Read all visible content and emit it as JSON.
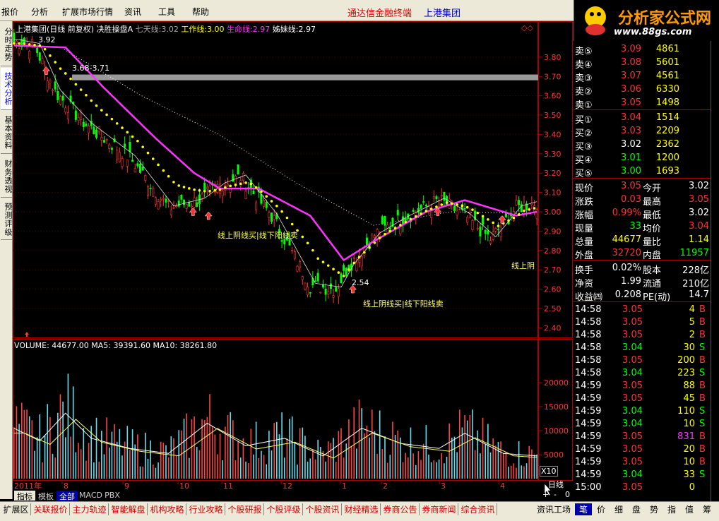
{
  "menu": {
    "items": [
      "报价",
      "分析",
      "扩展市场行情",
      "资讯",
      "工具",
      "帮助"
    ],
    "vendor": "通达信金融终端",
    "stock": "上港集团"
  },
  "logo": {
    "brand": "分析家公式网",
    "url": "www.88gs.com"
  },
  "vtabs": [
    "分时走势",
    "技术分析",
    "基本资料",
    "财务透视",
    "预测评级"
  ],
  "header": {
    "stock": "上港集团(日线 前复权)",
    "formula": "决胜操盘A",
    "ma7_label": "七天线:",
    "ma7_value": "3.02",
    "work_label": "工作线:",
    "work_value": "3.00",
    "life_label": "生命线:",
    "life_value": "2.97",
    "sister_label": "姊妹线:",
    "sister_value": "2.97",
    "diamond": "◇◇"
  },
  "price_axis": [
    "3.80",
    "3.70",
    "3.60",
    "3.50",
    "3.40",
    "3.30",
    "3.20",
    "3.10",
    "3.00",
    "2.90",
    "2.80",
    "2.70",
    "2.60",
    "2.50",
    "2.40"
  ],
  "annotations": {
    "high": "3.92",
    "band": "3.68-3.71",
    "low": "2.54",
    "signal1": "线上阴线买|线下阳线卖",
    "signal2": "线上阴线买|线下阳线卖",
    "signal3": "线上阴"
  },
  "volume": {
    "header": "VOLUME: 44677.00  MA5: 39391.60  MA10: 38261.80",
    "axis": [
      "20000",
      "15000",
      "10000",
      "5000"
    ],
    "unit": "X10"
  },
  "date_axis": {
    "year": "2011年",
    "months": [
      "8",
      "9",
      "10",
      "11",
      "12",
      "1",
      "2",
      "3",
      "4"
    ],
    "period": "日线"
  },
  "zoom": {
    "plus": "+",
    "minus": "-",
    "value": "0"
  },
  "chart_tabs": [
    "指标",
    "模板",
    "全部",
    "MACD",
    "PBX"
  ],
  "bottom_tabs": [
    "扩展区",
    "关联报价",
    "主力轨迹",
    "智能解盘",
    "机构攻略",
    "行业攻略",
    "个股研报",
    "个股评级",
    "个股资讯",
    "财经精选",
    "券商公告",
    "券商新闻",
    "综合资讯"
  ],
  "bottom_right_tab": "资讯工场",
  "right_tabs": [
    "笔",
    "价",
    "细",
    "盘",
    "势",
    "指",
    "值",
    "筹"
  ],
  "quote": {
    "asks": [
      {
        "label": "卖⑤",
        "price": "3.09",
        "vol": "4861"
      },
      {
        "label": "卖④",
        "price": "3.08",
        "vol": "5601"
      },
      {
        "label": "卖③",
        "price": "3.07",
        "vol": "4561"
      },
      {
        "label": "卖②",
        "price": "3.06",
        "vol": "6330"
      },
      {
        "label": "卖①",
        "price": "3.05",
        "vol": "1498"
      }
    ],
    "bids": [
      {
        "label": "买①",
        "price": "3.04",
        "vol": "1514"
      },
      {
        "label": "买②",
        "price": "3.03",
        "vol": "2209"
      },
      {
        "label": "买③",
        "price": "3.02",
        "vol": "2362"
      },
      {
        "label": "买④",
        "price": "3.01",
        "vol": "1200"
      },
      {
        "label": "买⑤",
        "price": "3.00",
        "vol": "1693"
      }
    ],
    "stats": [
      {
        "l1": "现价",
        "v1": "3.05",
        "c1": "#ff3333",
        "l2": "今开",
        "v2": "3.02",
        "c2": "#ffffff"
      },
      {
        "l1": "涨跌",
        "v1": "0.03",
        "c1": "#ff3333",
        "l2": "最高",
        "v2": "3.05",
        "c2": "#ff3333"
      },
      {
        "l1": "涨幅",
        "v1": "0.99%",
        "c1": "#ff3333",
        "l2": "最低",
        "v2": "3.02",
        "c2": "#ffffff"
      },
      {
        "l1": "现量",
        "v1": "33",
        "c1": "#00ff00",
        "l2": "均价",
        "v2": "3.04",
        "c2": "#ff3333"
      },
      {
        "l1": "总量",
        "v1": "44677",
        "c1": "#ffff00",
        "l2": "量比",
        "v2": "1.14",
        "c2": "#ffff00"
      },
      {
        "l1": "外盘",
        "v1": "32720",
        "c1": "#ff3333",
        "l2": "内盘",
        "v2": "11957",
        "c2": "#00ff00"
      }
    ],
    "fin": [
      {
        "l1": "换手",
        "v1": "0.02%",
        "l2": "股本",
        "v2": "228亿"
      },
      {
        "l1": "净资",
        "v1": "1.99",
        "l2": "流通",
        "v2": "210亿"
      },
      {
        "l1": "收益㈣",
        "v1": "0.208",
        "l2": "PE(动)",
        "v2": "14.7"
      }
    ]
  },
  "ticks": [
    {
      "t": "14:58",
      "p": "3.05",
      "v": "4",
      "s": "B"
    },
    {
      "t": "14:58",
      "p": "3.05",
      "v": "5",
      "s": "B"
    },
    {
      "t": "14:58",
      "p": "3.05",
      "v": "2",
      "s": "B"
    },
    {
      "t": "14:58",
      "p": "3.04",
      "v": "30",
      "s": "S"
    },
    {
      "t": "14:58",
      "p": "3.05",
      "v": "200",
      "s": "B"
    },
    {
      "t": "14:58",
      "p": "3.04",
      "v": "223",
      "s": "S"
    },
    {
      "t": "14:59",
      "p": "3.05",
      "v": "88",
      "s": "B"
    },
    {
      "t": "14:59",
      "p": "3.05",
      "v": "45",
      "s": "B"
    },
    {
      "t": "14:59",
      "p": "3.04",
      "v": "110",
      "s": "S"
    },
    {
      "t": "14:59",
      "p": "3.04",
      "v": "10",
      "s": "S"
    },
    {
      "t": "14:59",
      "p": "3.05",
      "v": "831",
      "s": "B"
    },
    {
      "t": "14:59",
      "p": "3.05",
      "v": "20",
      "s": "B"
    },
    {
      "t": "14:59",
      "p": "3.05",
      "v": "10",
      "s": "B"
    },
    {
      "t": "14:59",
      "p": "3.04",
      "v": "33",
      "s": "S"
    },
    {
      "t": "15:00",
      "p": "3.05",
      "v": "0",
      "s": ""
    }
  ],
  "chart_data": {
    "type": "candlestick",
    "price_range": [
      2.35,
      3.92
    ],
    "volume_range": [
      0,
      25000
    ],
    "close_keypoints": [
      [
        0,
        3.88
      ],
      [
        8,
        3.86
      ],
      [
        16,
        3.62
      ],
      [
        28,
        3.45
      ],
      [
        45,
        3.28
      ],
      [
        60,
        3.02
      ],
      [
        72,
        3.06
      ],
      [
        80,
        3.14
      ],
      [
        88,
        3.18
      ],
      [
        100,
        2.98
      ],
      [
        115,
        2.62
      ],
      [
        125,
        2.6
      ],
      [
        130,
        2.72
      ],
      [
        140,
        2.88
      ],
      [
        150,
        2.96
      ],
      [
        165,
        3.06
      ],
      [
        175,
        2.98
      ],
      [
        185,
        2.86
      ],
      [
        195,
        3.02
      ],
      [
        203,
        3.05
      ]
    ],
    "life_line_keypoints": [
      [
        0,
        3.86
      ],
      [
        20,
        3.85
      ],
      [
        35,
        3.64
      ],
      [
        55,
        3.38
      ],
      [
        70,
        3.2
      ],
      [
        80,
        3.12
      ],
      [
        95,
        3.12
      ],
      [
        115,
        2.98
      ],
      [
        128,
        2.75
      ],
      [
        140,
        2.85
      ],
      [
        160,
        3.0
      ],
      [
        175,
        3.06
      ],
      [
        195,
        2.98
      ],
      [
        203,
        3.0
      ]
    ],
    "ma_slow_keypoints": [
      [
        20,
        3.84
      ],
      [
        50,
        3.6
      ],
      [
        80,
        3.4
      ],
      [
        110,
        3.15
      ],
      [
        140,
        2.93
      ],
      [
        170,
        3.0
      ],
      [
        203,
        2.99
      ]
    ],
    "price_band": [
      3.68,
      3.71
    ],
    "arrows_up": [
      [
        13,
        3.75
      ],
      [
        70,
        3.02
      ],
      [
        76,
        3.0
      ],
      [
        132,
        2.62
      ],
      [
        165,
        3.02
      ],
      [
        190,
        2.98
      ]
    ],
    "volume_keypoints": [
      [
        0,
        10000
      ],
      [
        10,
        7500
      ],
      [
        20,
        13000
      ],
      [
        30,
        8000
      ],
      [
        45,
        6000
      ],
      [
        60,
        5000
      ],
      [
        75,
        11000
      ],
      [
        90,
        6500
      ],
      [
        105,
        8000
      ],
      [
        120,
        4500
      ],
      [
        135,
        10000
      ],
      [
        150,
        7000
      ],
      [
        165,
        6000
      ],
      [
        175,
        9000
      ],
      [
        190,
        5000
      ],
      [
        203,
        4500
      ]
    ]
  }
}
